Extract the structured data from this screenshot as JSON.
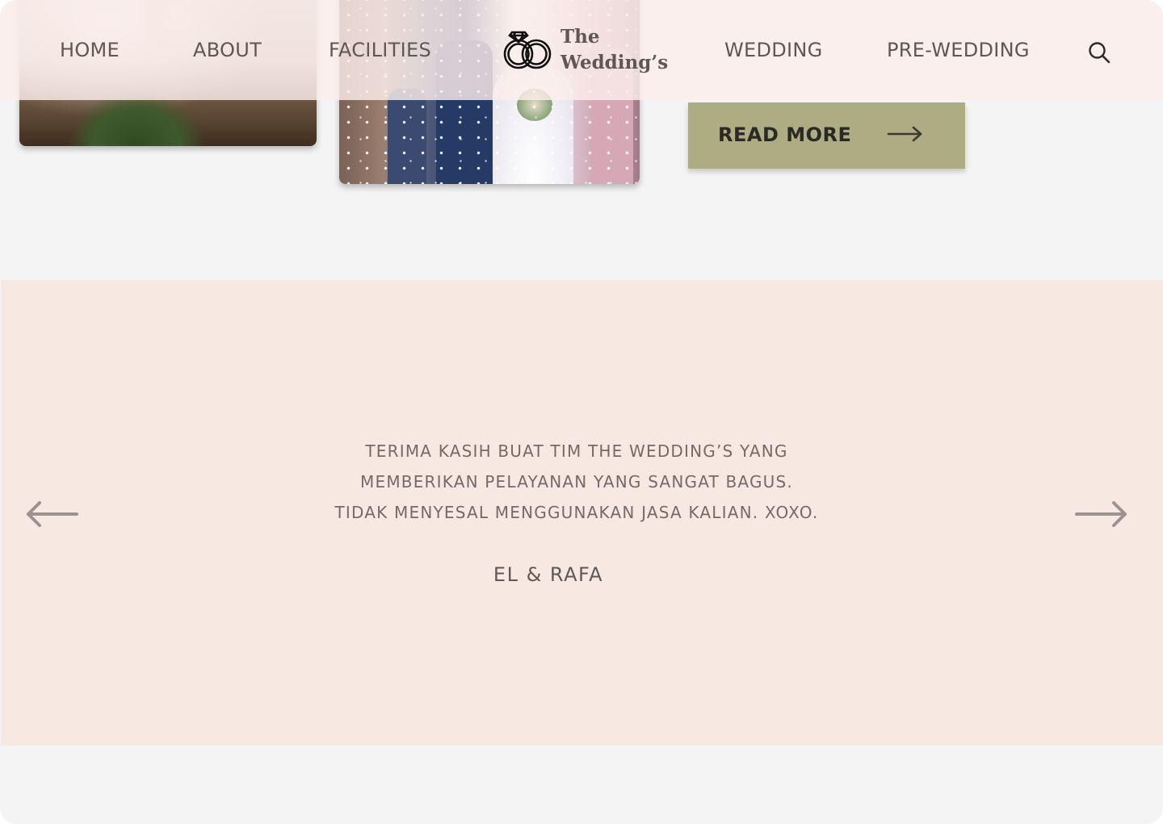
{
  "nav": {
    "links": [
      "HOME",
      "ABOUT",
      "FACILITIES",
      "WEDDING",
      "PRE-WEDDING"
    ],
    "brand": {
      "line1": "The",
      "line2": "Wedding’s"
    },
    "search_icon": "search-icon"
  },
  "read_more": {
    "label": "READ MORE",
    "icon": "arrow-right-icon"
  },
  "testimonial": {
    "lines": [
      "TERIMA KASIH BUAT TIM THE WEDDING’S YANG",
      "MEMBERIKAN PELAYANAN YANG SANGAT BAGUS.",
      "TIDAK MENYESAL MENGGUNAKAN JASA KALIAN. XOXO."
    ],
    "author": "EL & RAFA",
    "prev_icon": "arrow-left-icon",
    "next_icon": "arrow-right-icon"
  },
  "colors": {
    "navbar_bg": "#fceeec",
    "button_bg": "#aeac82",
    "testimonial_bg": "#f7e9e1",
    "page_bg": "#f4f4f4",
    "text": "#5e5752",
    "arrow": "#9c928e"
  }
}
